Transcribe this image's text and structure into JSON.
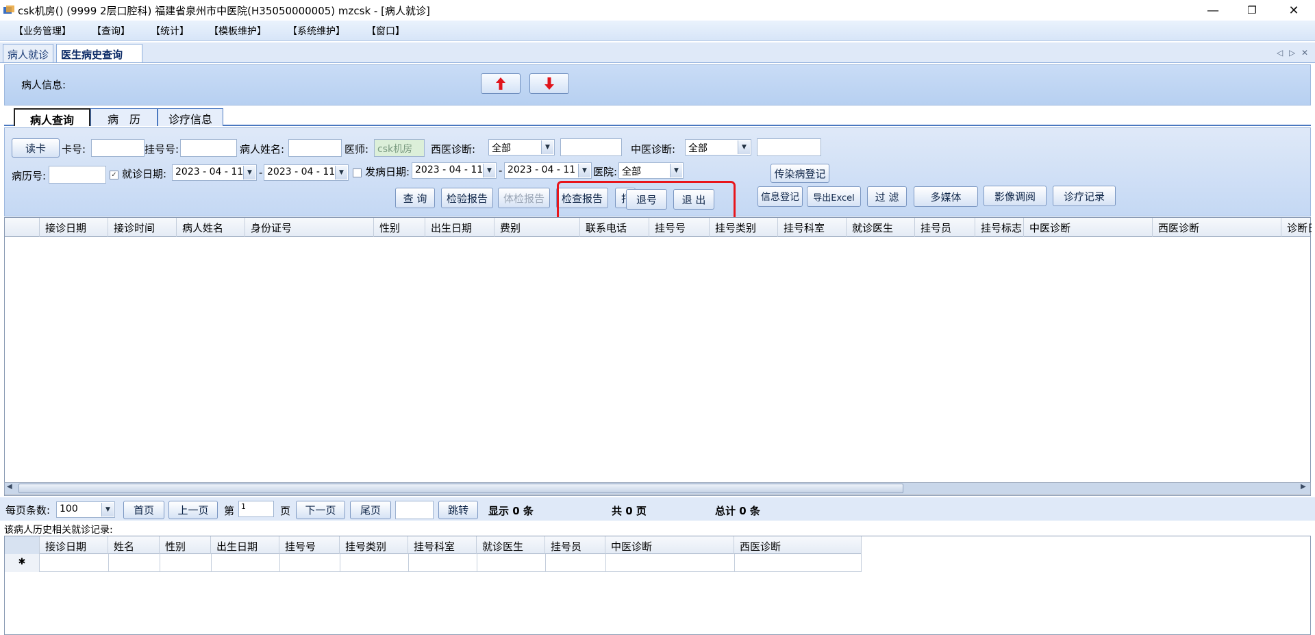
{
  "window": {
    "title": "csk机房() (9999 2层口腔科) 福建省泉州市中医院(H35050000005) mzcsk - [病人就诊]",
    "controls": {
      "minimize": "—",
      "restore": "❐",
      "close": "✕"
    }
  },
  "menu": [
    "【业务管理】",
    "【查询】",
    "【统计】",
    "【模板维护】",
    "【系统维护】",
    "【窗口】"
  ],
  "doc_tabs": [
    "病人就诊",
    "医生病史查询"
  ],
  "tab_nav": {
    "prev": "◁",
    "next": "▷",
    "close": "✕"
  },
  "patient_info": {
    "label": "病人信息:"
  },
  "sub_tabs": [
    "病人查询",
    "病　历",
    "诊疗信息"
  ],
  "search": {
    "read_card": "读卡",
    "card_no_label": "卡号:",
    "card_no_value": "",
    "reg_no_label": "挂号号:",
    "reg_no_value": "",
    "patient_name_label": "病人姓名:",
    "patient_name_value": "",
    "doctor_label": "医师:",
    "doctor_value": "csk机房",
    "western_diag_label": "西医诊断:",
    "western_diag_select": "全部",
    "western_diag_value": "",
    "tcm_diag_label": "中医诊断:",
    "tcm_diag_select": "全部",
    "tcm_diag_value": "",
    "record_no_label": "病历号:",
    "record_no_value": "",
    "visit_date_label": "就诊日期:",
    "visit_date_from": "2023 - 04 - 11",
    "visit_date_to": "2023 - 04 - 11",
    "visit_date_checked": true,
    "onset_date_label": "发病日期:",
    "onset_date_from": "2023 - 04 - 11",
    "onset_date_to": "2023 - 04 - 11",
    "onset_date_checked": false,
    "hospital_label": "医院:",
    "hospital_select": "全部",
    "range_dash": "-"
  },
  "buttons": {
    "infect_report": "传染病登记",
    "query": "查 询",
    "lab_report": "检验报告",
    "physical_report": "体检报告",
    "exam_report": "检查报告",
    "partial_hidden": "打",
    "cancel_reg": "退号",
    "exit": "退 出",
    "info_reg": "信息登记",
    "export_excel": "导出Excel",
    "filter": "过 滤",
    "multimedia": "多媒体",
    "imaging": "影像调阅",
    "treatment_record": "诊疗记录"
  },
  "grid_columns": [
    "接诊日期",
    "接诊时间",
    "病人姓名",
    "身份证号",
    "性别",
    "出生日期",
    "费别",
    "联系电话",
    "挂号号",
    "挂号类别",
    "挂号科室",
    "就诊医生",
    "挂号员",
    "挂号标志",
    "中医诊断",
    "西医诊断",
    "诊断日"
  ],
  "pager": {
    "page_size_label": "每页条数:",
    "page_size": "100",
    "first": "首页",
    "prev": "上一页",
    "page_prefix": "第",
    "page_value": "1",
    "page_suffix": "页",
    "next": "下一页",
    "last": "尾页",
    "jump_value": "",
    "jump": "跳转",
    "shown": "显示 0 条",
    "total_pages": "共 0 页",
    "total": "总计 0 条"
  },
  "history": {
    "label": "该病人历史相关就诊记录:",
    "columns": [
      "接诊日期",
      "姓名",
      "性别",
      "出生日期",
      "挂号号",
      "挂号类别",
      "挂号科室",
      "就诊医生",
      "挂号员",
      "中医诊断",
      "西医诊断"
    ],
    "new_row_marker": "✱"
  },
  "colors": {
    "highlight": "#e8151b",
    "accent": "#4a78c0"
  }
}
